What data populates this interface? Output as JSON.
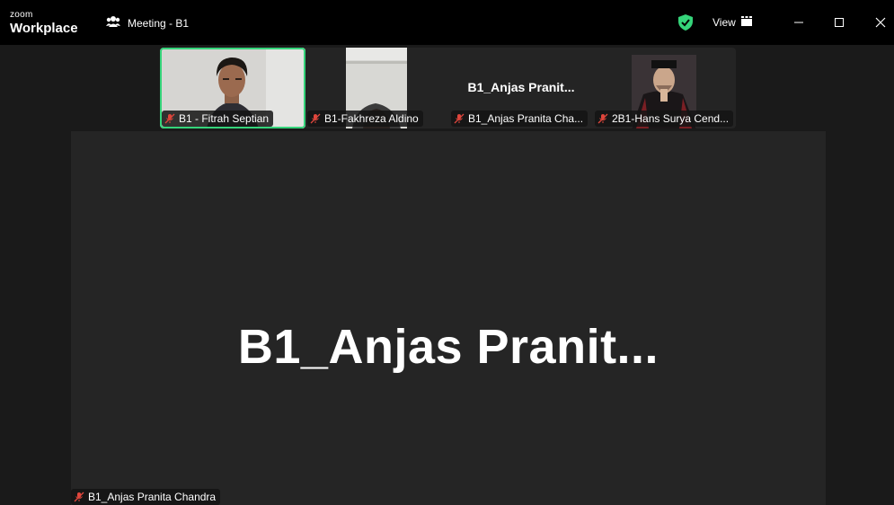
{
  "app": {
    "logo_top": "zoom",
    "logo_bottom": "Workplace",
    "meeting_title": "Meeting - B1",
    "view_label": "View"
  },
  "gallery": [
    {
      "name": "B1 - Fitrah Septian",
      "muted": true,
      "active": true,
      "display": "video"
    },
    {
      "name": "B1-Fakhreza Aldino",
      "muted": true,
      "active": false,
      "display": "video"
    },
    {
      "name": "B1_Anjas Pranita Cha...",
      "muted": true,
      "active": false,
      "display": "name",
      "display_name": "B1_Anjas  Pranit..."
    },
    {
      "name": "2B1-Hans Surya Cend...",
      "muted": true,
      "active": false,
      "display": "video"
    }
  ],
  "speaker": {
    "display_name": "B1_Anjas  Pranit...",
    "tag": "B1_Anjas Pranita Chandra",
    "muted": true
  },
  "colors": {
    "accent_green": "#35d47a",
    "muted_red": "#e0463c",
    "background": "#1a1a1a"
  }
}
